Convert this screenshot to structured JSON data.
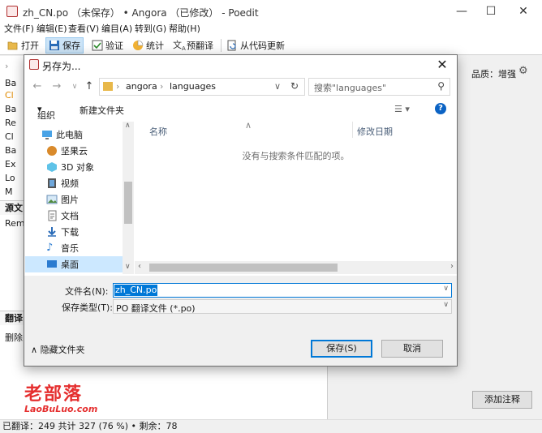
{
  "window": {
    "title": "zh_CN.po （未保存） • Angora （已修改） - Poedit"
  },
  "menu": [
    "文件(F)",
    "编辑(E)",
    "查看(V)",
    "编目(A)",
    "转到(G)",
    "帮助(H)"
  ],
  "toolbar": {
    "open": "打开",
    "save": "保存",
    "validate": "验证",
    "stats": "统计",
    "pretranslate": "预翻译",
    "update_from_code": "从代码更新"
  },
  "left_pane": {
    "rows": [
      "Ba",
      "Cl",
      "Ba",
      "Re",
      "Cl",
      "Ba",
      "Ex",
      "Lo",
      "M"
    ],
    "source_header": "源文",
    "source_text": "Rem",
    "translation_header": "翻译",
    "translation_text": "删除"
  },
  "right_pane": {
    "quality_label": "品质：增强",
    "add_note_button": "添加注释"
  },
  "watermark": {
    "title": "老部落",
    "url": "LaoBuLuo.com"
  },
  "statusbar": {
    "text": "已翻译：249 共计 327 (76 %) • 剩余：78"
  },
  "dialog": {
    "title": "另存为...",
    "breadcrumb": [
      "angora",
      "languages"
    ],
    "search_placeholder": "搜索\"languages\"",
    "organize": "组织",
    "new_folder": "新建文件夹",
    "nav_items": [
      "此电脑",
      "坚果云",
      "3D 对象",
      "视频",
      "图片",
      "文档",
      "下载",
      "音乐",
      "桌面"
    ],
    "columns": {
      "name": "名称",
      "modified": "修改日期"
    },
    "empty_message": "没有与搜索条件匹配的项。",
    "filename_label": "文件名(N):",
    "filename_value": "zh_CN.po",
    "filetype_label": "保存类型(T):",
    "filetype_value": "PO 翻译文件 (*.po)",
    "hide_folders": "隐藏文件夹",
    "save_button": "保存(S)",
    "cancel_button": "取消"
  },
  "colors": {
    "accent": "#0078d7",
    "selection": "#cce8ff",
    "watermark": "#e52f2f"
  }
}
